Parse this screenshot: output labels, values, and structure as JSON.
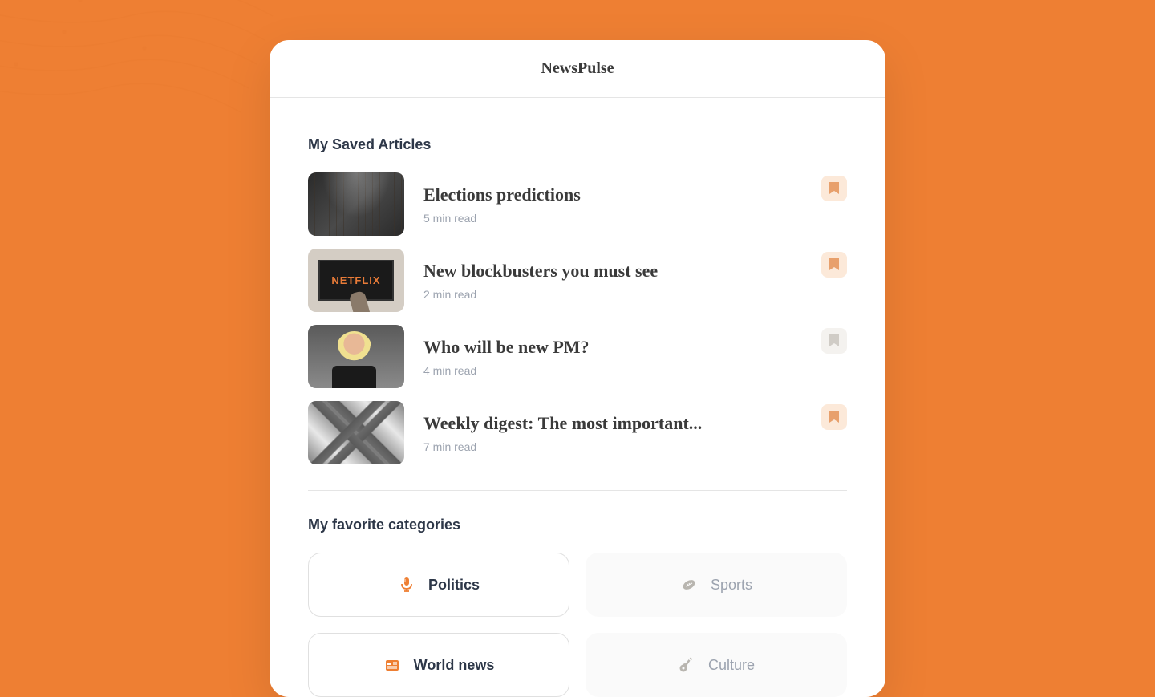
{
  "app": {
    "title": "NewsPulse"
  },
  "sections": {
    "saved_title": "My Saved Articles",
    "categories_title": "My favorite categories"
  },
  "articles": [
    {
      "title": "Elections predictions",
      "read_time": "5 min read",
      "bookmarked": true
    },
    {
      "title": "New blockbusters you must see",
      "read_time": "2 min read",
      "bookmarked": true
    },
    {
      "title": "Who will be new PM?",
      "read_time": "4 min read",
      "bookmarked": false
    },
    {
      "title": "Weekly digest: The most important...",
      "read_time": "7 min read",
      "bookmarked": true
    }
  ],
  "categories": [
    {
      "label": "Politics",
      "active": true,
      "icon": "microphone"
    },
    {
      "label": "Sports",
      "active": false,
      "icon": "football"
    },
    {
      "label": "World news",
      "active": true,
      "icon": "news"
    },
    {
      "label": "Culture",
      "active": false,
      "icon": "guitar"
    }
  ],
  "colors": {
    "accent": "#ee7f33",
    "bookmark_active": "#e8a06c"
  }
}
